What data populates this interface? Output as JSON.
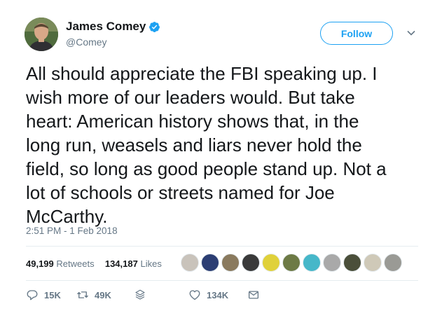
{
  "author": {
    "name": "James Comey",
    "handle": "@Comey",
    "verified": true
  },
  "follow_label": "Follow",
  "text_lines": [
    "All should appreciate the FBI speaking up. I",
    "wish more of our leaders would. But take",
    "heart: American history shows that, in the",
    "long run, weasels and liars never hold the",
    "field, so long as good people stand up. Not a",
    "lot of schools or streets named for Joe",
    "McCarthy."
  ],
  "timestamp": "2:51 PM - 1 Feb 2018",
  "stats": {
    "retweets_count": "49,199",
    "retweets_label": "Retweets",
    "likes_count": "134,187",
    "likes_label": "Likes"
  },
  "actions": {
    "replies": "15K",
    "retweets": "49K",
    "likes": "134K"
  },
  "colors": {
    "accent": "#1da1f2",
    "muted": "#657786",
    "divider": "#e6ecf0"
  },
  "facepile_colors": [
    "#c9c3bb",
    "#2c3e73",
    "#8a7a5e",
    "#3a3a3a",
    "#e0d13a",
    "#6d7a45",
    "#46b7c9",
    "#a9a9a9",
    "#4b4f3a",
    "#cfc9b8",
    "#9a9a95"
  ]
}
